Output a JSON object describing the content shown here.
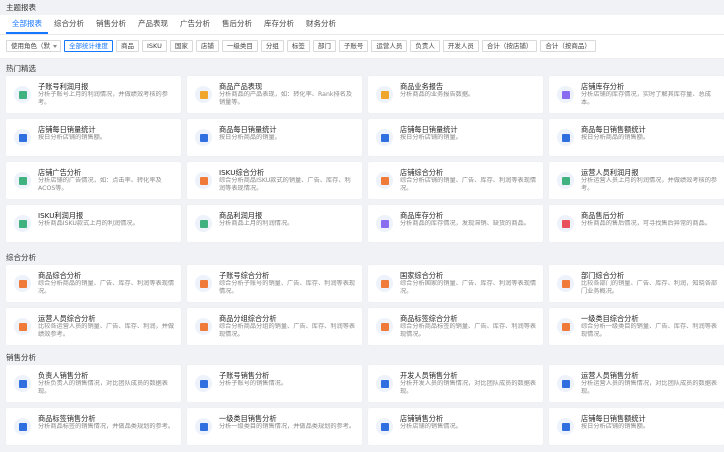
{
  "header": {
    "title": "主题报表"
  },
  "tabs": [
    {
      "label": "全部报表",
      "active": true
    },
    {
      "label": "综合分析"
    },
    {
      "label": "销售分析"
    },
    {
      "label": "产品表现"
    },
    {
      "label": "广告分析"
    },
    {
      "label": "售后分析"
    },
    {
      "label": "库存分析"
    },
    {
      "label": "财务分析"
    }
  ],
  "filters": [
    {
      "label": "使用角色（默",
      "type": "select"
    },
    {
      "label": "全部统计维度",
      "active": true
    },
    {
      "label": "商品"
    },
    {
      "label": "ISKU"
    },
    {
      "label": "国家"
    },
    {
      "label": "店铺"
    },
    {
      "label": "一级类目"
    },
    {
      "label": "分组"
    },
    {
      "label": "标签"
    },
    {
      "label": "部门"
    },
    {
      "label": "子账号"
    },
    {
      "label": "运营人员"
    },
    {
      "label": "负责人"
    },
    {
      "label": "开发人员"
    },
    {
      "label": "合计（按店铺）"
    },
    {
      "label": "合计（按商品）"
    }
  ],
  "sections": [
    {
      "title": "热门精选",
      "cards": [
        {
          "title": "子账号利润月报",
          "desc": "分析子账号上月的利润情况，并做绩效考核的参考。",
          "icon": "org-icon",
          "color": "#3fb27f"
        },
        {
          "title": "商品产品表现",
          "desc": "分析商品的产品表现，如：转化率、Rank排名及销量等。",
          "icon": "box-icon",
          "color": "#f0a52d"
        },
        {
          "title": "商品业务报告",
          "desc": "分析商品的业务报告数据。",
          "icon": "box-icon",
          "color": "#f0a52d"
        },
        {
          "title": "店铺库存分析",
          "desc": "分析店铺的库存情况，实时了解其库存量、总成本。",
          "icon": "store-icon",
          "color": "#8a6cf0"
        },
        {
          "title": "店铺每日销量统计",
          "desc": "按日分析店铺的销售额。",
          "icon": "store-icon",
          "color": "#2f6fe0"
        },
        {
          "title": "商品每日销量统计",
          "desc": "按日分析商品的销量。",
          "icon": "box-icon",
          "color": "#2f6fe0"
        },
        {
          "title": "店铺每日销量统计",
          "desc": "按日分析店铺的销量。",
          "icon": "store-icon",
          "color": "#2f6fe0"
        },
        {
          "title": "商品每日销售额统计",
          "desc": "按日分析商品的销售额。",
          "icon": "box-icon",
          "color": "#2f6fe0"
        },
        {
          "title": "店铺广告分析",
          "desc": "分析店铺的广告情况，如：点击率、转化率及ACOS等。",
          "icon": "store-icon",
          "color": "#3fb27f"
        },
        {
          "title": "ISKU综合分析",
          "desc": "综合分析商品ISKU款式的销量、广告、库存、利润等表现情况。",
          "icon": "isku-icon",
          "color": "#f07a3a"
        },
        {
          "title": "店铺综合分析",
          "desc": "综合分析店铺的销量、广告、库存、利润等表现情况。",
          "icon": "store-icon",
          "color": "#f07a3a"
        },
        {
          "title": "运营人员利润月报",
          "desc": "分析运营人员上月的利润情况，并做绩效考核的参考。",
          "icon": "user-icon",
          "color": "#3fb27f"
        },
        {
          "title": "ISKU利润月报",
          "desc": "分析商品ISKU款式上月的利润情况。",
          "icon": "isku-icon",
          "color": "#3fb27f"
        },
        {
          "title": "商品利润月报",
          "desc": "分析商品上月的利润情况。",
          "icon": "box-icon",
          "color": "#3fb27f"
        },
        {
          "title": "商品库存分析",
          "desc": "分析商品的库存情况，发现滞销、缺货的商品。",
          "icon": "box-icon",
          "color": "#8a6cf0"
        },
        {
          "title": "商品售后分析",
          "desc": "分析商品的售后情况，可寻找售后异常的商品。",
          "icon": "box-icon",
          "color": "#e8505b"
        }
      ]
    },
    {
      "title": "综合分析",
      "cards": [
        {
          "title": "商品综合分析",
          "desc": "综合分析商品的销量、广告、库存、利润等表现情况。",
          "icon": "box-icon",
          "color": "#f07a3a"
        },
        {
          "title": "子账号综合分析",
          "desc": "综合分析子账号的销量、广告、库存、利润等表现情况。",
          "icon": "org-icon",
          "color": "#f07a3a"
        },
        {
          "title": "国家综合分析",
          "desc": "综合分析国家的销量、广告、库存、利润等表现情况。",
          "icon": "globe-icon",
          "color": "#f07a3a"
        },
        {
          "title": "部门综合分析",
          "desc": "比较各部门的销量、广告、库存、利润，知晓各部门业务概况。",
          "icon": "team-icon",
          "color": "#f07a3a"
        },
        {
          "title": "运营人员综合分析",
          "desc": "比较各运营人员的销量、广告、库存、利润，并做绩效参考。",
          "icon": "user-icon",
          "color": "#f07a3a"
        },
        {
          "title": "商品分组综合分析",
          "desc": "综合分析商品分组的销量、广告、库存、利润等表现情况。",
          "icon": "layers-icon",
          "color": "#f07a3a"
        },
        {
          "title": "商品标签综合分析",
          "desc": "综合分析商品标签的销量、广告、库存、利润等表现情况。",
          "icon": "tag-icon",
          "color": "#f07a3a"
        },
        {
          "title": "一级类目综合分析",
          "desc": "综合分析一级类目的销量、广告、库存、利润等表现情况。",
          "icon": "grid-icon",
          "color": "#f07a3a"
        }
      ]
    },
    {
      "title": "销售分析",
      "cards": [
        {
          "title": "负责人销售分析",
          "desc": "分析负责人的销售情况，对比团队成员的数据表现。",
          "icon": "user-icon",
          "color": "#2f6fe0"
        },
        {
          "title": "子账号销售分析",
          "desc": "分析子账号的销售情况。",
          "icon": "org-icon",
          "color": "#2f6fe0"
        },
        {
          "title": "开发人员销售分析",
          "desc": "分析开发人员的销售情况，对比团队成员的数据表现。",
          "icon": "dev-icon",
          "color": "#2f6fe0"
        },
        {
          "title": "运营人员销售分析",
          "desc": "分析运营人员的销售情况，对比团队成员的数据表现。",
          "icon": "user-icon",
          "color": "#2f6fe0"
        },
        {
          "title": "商品标签销售分析",
          "desc": "分析商品标签的销售情况，并做品类规划的参考。",
          "icon": "tag-icon",
          "color": "#2f6fe0"
        },
        {
          "title": "一级类目销售分析",
          "desc": "分析一级类目的销售情况，并做品类规划的参考。",
          "icon": "grid-icon",
          "color": "#2f6fe0"
        },
        {
          "title": "店铺销售分析",
          "desc": "分析店铺的销售情况。",
          "icon": "store-icon",
          "color": "#2f6fe0"
        },
        {
          "title": "店铺每日销售额统计",
          "desc": "按日分析店铺的销售额。",
          "icon": "store-icon",
          "color": "#2f6fe0"
        }
      ]
    }
  ]
}
